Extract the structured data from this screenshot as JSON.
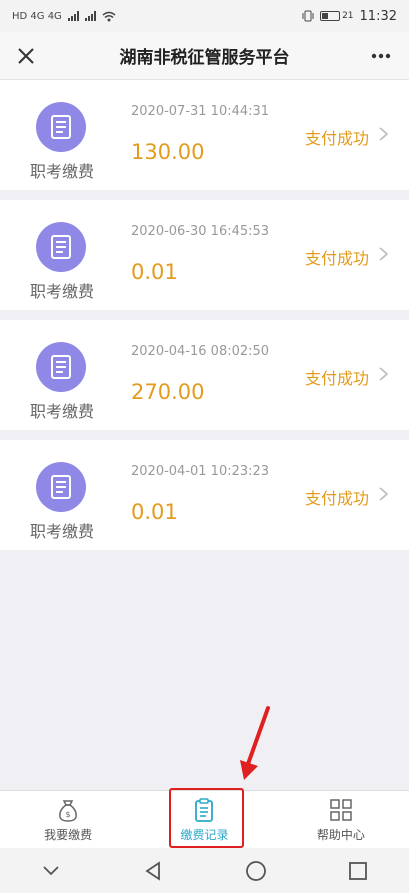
{
  "status_bar": {
    "indicators": "HD 4G 4G",
    "battery": "21",
    "time": "11:32"
  },
  "header": {
    "title": "湖南非税征管服务平台",
    "close_icon": "close-icon",
    "more_icon": "more-icon"
  },
  "payments": [
    {
      "category": "职考缴费",
      "datetime": "2020-07-31 10:44:31",
      "amount": "130.00",
      "status": "支付成功"
    },
    {
      "category": "职考缴费",
      "datetime": "2020-06-30 16:45:53",
      "amount": "0.01",
      "status": "支付成功"
    },
    {
      "category": "职考缴费",
      "datetime": "2020-04-16 08:02:50",
      "amount": "270.00",
      "status": "支付成功"
    },
    {
      "category": "职考缴费",
      "datetime": "2020-04-01 10:23:23",
      "amount": "0.01",
      "status": "支付成功"
    }
  ],
  "tabs": [
    {
      "label": "我要缴费",
      "icon": "money-bag-icon",
      "active": false
    },
    {
      "label": "缴费记录",
      "icon": "clipboard-icon",
      "active": true
    },
    {
      "label": "帮助中心",
      "icon": "grid-icon",
      "active": false
    }
  ],
  "colors": {
    "accent_orange": "#e39b1d",
    "icon_purple": "#8f88e6",
    "active_tab": "#2ba8c9",
    "highlight_red": "#e02020"
  }
}
